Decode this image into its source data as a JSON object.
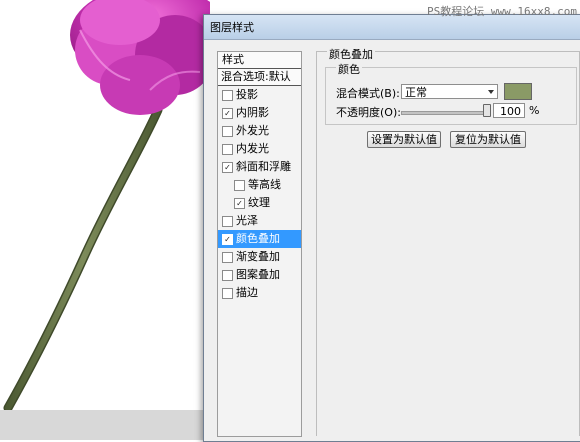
{
  "watermark": "PS教程论坛 www.16xx8.com",
  "dialog": {
    "title": "图层样式"
  },
  "left_panel": {
    "header": "样式",
    "blend_options": "混合选项:默认",
    "items": [
      {
        "label": "投影",
        "checked": false
      },
      {
        "label": "内阴影",
        "checked": true
      },
      {
        "label": "外发光",
        "checked": false
      },
      {
        "label": "内发光",
        "checked": false
      },
      {
        "label": "斜面和浮雕",
        "checked": true
      },
      {
        "label": "等高线",
        "checked": false
      },
      {
        "label": "纹理",
        "checked": true
      },
      {
        "label": "光泽",
        "checked": false
      },
      {
        "label": "颜色叠加",
        "checked": true,
        "selected": true
      },
      {
        "label": "渐变叠加",
        "checked": false
      },
      {
        "label": "图案叠加",
        "checked": false
      },
      {
        "label": "描边",
        "checked": false
      }
    ]
  },
  "color_overlay": {
    "group_title": "颜色叠加",
    "sub_title": "颜色",
    "blend_mode_label": "混合模式(B):",
    "blend_mode_value": "正常",
    "color": "#8a9a66",
    "opacity_label": "不透明度(O):",
    "opacity_value": "100",
    "opacity_percent": 100,
    "opacity_unit": "%",
    "set_default_label": "设置为默认值",
    "reset_default_label": "复位为默认值"
  }
}
